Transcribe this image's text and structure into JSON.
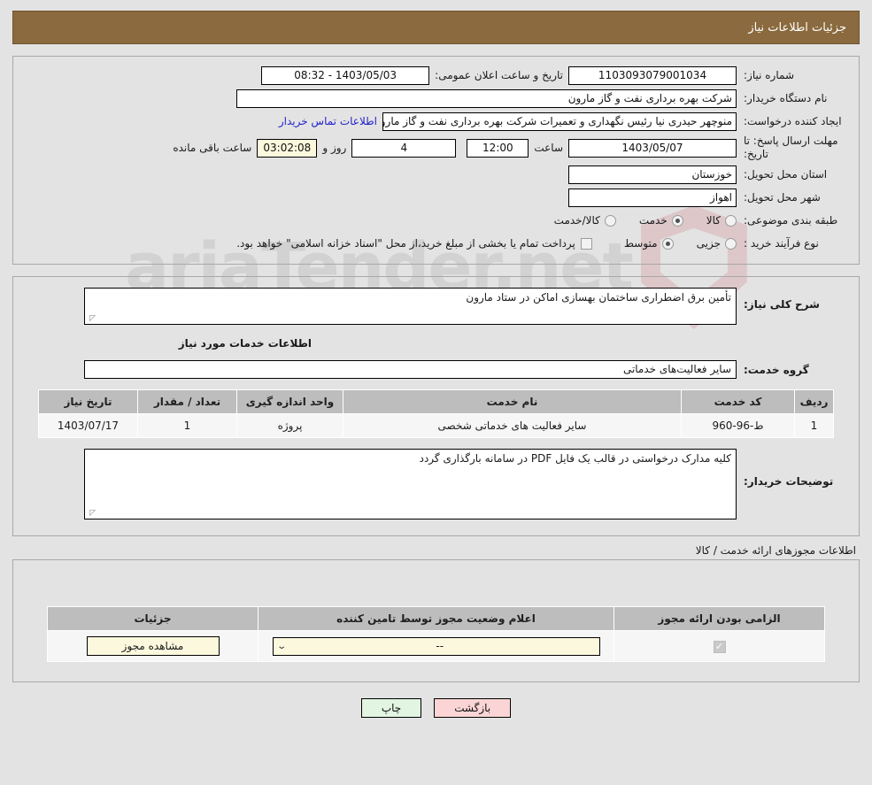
{
  "header": {
    "title": "جزئیات اطلاعات نیاز"
  },
  "form": {
    "need_number_label": "شماره نیاز:",
    "need_number_value": "1103093079001034",
    "announce_label": "تاریخ و ساعت اعلان عمومی:",
    "announce_value": "1403/05/03 - 08:32",
    "buyer_org_label": "نام دستگاه خریدار:",
    "buyer_org_value": "شرکت بهره برداری نفت و گاز مارون",
    "creator_label": "ایجاد کننده درخواست:",
    "creator_value": "منوچهر حیدری نیا رئیس نگهداری و تعمیرات شرکت بهره برداری نفت و گاز مارون",
    "contact_link": "اطلاعات تماس خریدار",
    "deadline_label": "مهلت ارسال پاسخ: تا تاریخ:",
    "deadline_date": "1403/05/07",
    "hour_label": "ساعت",
    "hour_value": "12:00",
    "days_value": "4",
    "days_label": "روز و",
    "countdown_value": "03:02:08",
    "remaining_label": "ساعت باقی مانده",
    "province_label": "استان محل تحویل:",
    "province_value": "خوزستان",
    "city_label": "شهر محل تحویل:",
    "city_value": "اهواز",
    "category_label": "طبقه بندی موضوعی:",
    "category_options": [
      {
        "label": "کالا",
        "selected": false
      },
      {
        "label": "خدمت",
        "selected": true
      },
      {
        "label": "کالا/خدمت",
        "selected": false
      }
    ],
    "process_label": "نوع فرآیند خرید :",
    "process_options": [
      {
        "label": "جزیی",
        "selected": false
      },
      {
        "label": "متوسط",
        "selected": true
      }
    ],
    "treasury_checked": false,
    "treasury_note": "پرداخت تمام یا بخشی از مبلغ خرید،از محل \"اسناد خزانه اسلامی\" خواهد بود."
  },
  "details": {
    "general_desc_label": "شرح کلی نیاز:",
    "general_desc_value": "تأمین برق اضطراری ساختمان بهسازی اماکن در ستاد مارون",
    "services_section_title": "اطلاعات خدمات مورد نیاز",
    "service_group_label": "گروه خدمت:",
    "service_group_value": "سایر فعالیت‌های خدماتی",
    "buyer_notes_label": "توضیحات خریدار:",
    "buyer_notes_value": "کلیه مدارک درخواستی در قالب یک فایل PDF در سامانه بارگذاری گردد"
  },
  "items_table": {
    "columns": [
      "ردیف",
      "کد خدمت",
      "نام خدمت",
      "واحد اندازه گیری",
      "تعداد / مقدار",
      "تاریخ نیاز"
    ],
    "rows": [
      {
        "row_no": "1",
        "service_code": "ط-96-960",
        "service_name": "سایر فعالیت های خدماتی شخصی",
        "unit": "پروژه",
        "quantity": "1",
        "need_date": "1403/07/17"
      }
    ]
  },
  "licenses": {
    "caption": "اطلاعات مجوزهای ارائه خدمت / کالا",
    "columns": [
      "الزامی بودن ارائه مجوز",
      "اعلام وضعیت مجوز توسط تامین کننده",
      "جزئیات"
    ],
    "rows": [
      {
        "required": true,
        "required_mark": "✓",
        "status_value": "--",
        "details_button": "مشاهده مجوز"
      }
    ]
  },
  "footer": {
    "back_button": "بازگشت",
    "print_button": "چاپ"
  },
  "watermark": {
    "text": "ariaTender.net"
  },
  "colors": {
    "header_bg": "#8a6a3e",
    "back_button_bg": "#fbd5d5",
    "print_button_bg": "#e2f5e2",
    "link": "#2222cc",
    "table_header_bg": "#bdbdbd"
  }
}
